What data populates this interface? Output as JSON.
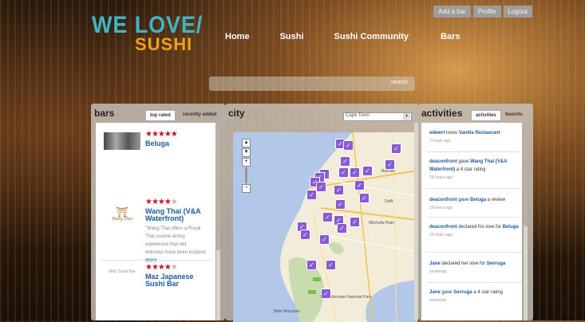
{
  "account": {
    "add_bar": "Add a bar",
    "profile": "Profile",
    "logout": "Logout"
  },
  "logo": {
    "line1": "WE LOVE/",
    "line2": "SUSHI"
  },
  "nav": {
    "home": "Home",
    "sushi": "Sushi",
    "community": "Sushi Community",
    "bars": "Bars"
  },
  "search": {
    "placeholder": "",
    "button": "search"
  },
  "bars_panel": {
    "title": "bars",
    "tabs": [
      "top rated",
      "recently added"
    ],
    "items": [
      {
        "name": "Beluga",
        "rating": 5,
        "stars": "★★★★★",
        "desc": "",
        "more": ""
      },
      {
        "name": "Wang Thai (V&A Waterfront)",
        "rating": 4,
        "stars": "★★★★",
        "empty_star": "★",
        "logo_text": "Wang Thai",
        "desc": "\"Wang Thai offers a Royal Thai cuisine dining experience that will delicious have been inspired",
        "more": "more"
      },
      {
        "name": "Maz Japanese Sushi Bar",
        "rating": 4,
        "stars": "★★★★",
        "empty_star": "★",
        "logo_text": "MAZ Sushi Bar",
        "desc": "",
        "more": ""
      }
    ]
  },
  "city_panel": {
    "title": "city",
    "select_value": "Cape Town",
    "map_labels": [
      "Bellville",
      "Delft",
      "Mitchells Plain",
      "Table Mountain National Park",
      "Table Mountain"
    ]
  },
  "activities_panel": {
    "title": "activities",
    "tabs": [
      "activities",
      "favorits"
    ],
    "items": [
      {
        "user": "edwert",
        "action": " loves ",
        "target": "Vanilla Restaurant",
        "time": "2 hours ago"
      },
      {
        "user": "deaconfront",
        "action": " gave ",
        "target": "Wang Thai (V&A Waterfront)",
        "suffix": " a 4 star rating",
        "time": "19 hours ago"
      },
      {
        "user": "deaconfront",
        "action": " gave ",
        "target": "Beluga",
        "suffix": " a review",
        "time": "19 hours ago"
      },
      {
        "user": "deaconfront",
        "action": " declared his love for ",
        "target": "Beluga",
        "time": "19 hours ago"
      },
      {
        "user": "Jane",
        "action": " declared her love for ",
        "target": "Sevruga",
        "time": "yesterday"
      },
      {
        "user": "Jane",
        "action": " gave ",
        "target": "Sevruga",
        "suffix": " a 4 star rating",
        "time": "yesterday"
      }
    ]
  },
  "colors": {
    "logo_cyan": "#3fb6c1",
    "logo_orange": "#f0a21a",
    "star_red": "#c0172a",
    "link_blue": "#1c5aa0",
    "pin_purple": "#8a5ad6"
  }
}
